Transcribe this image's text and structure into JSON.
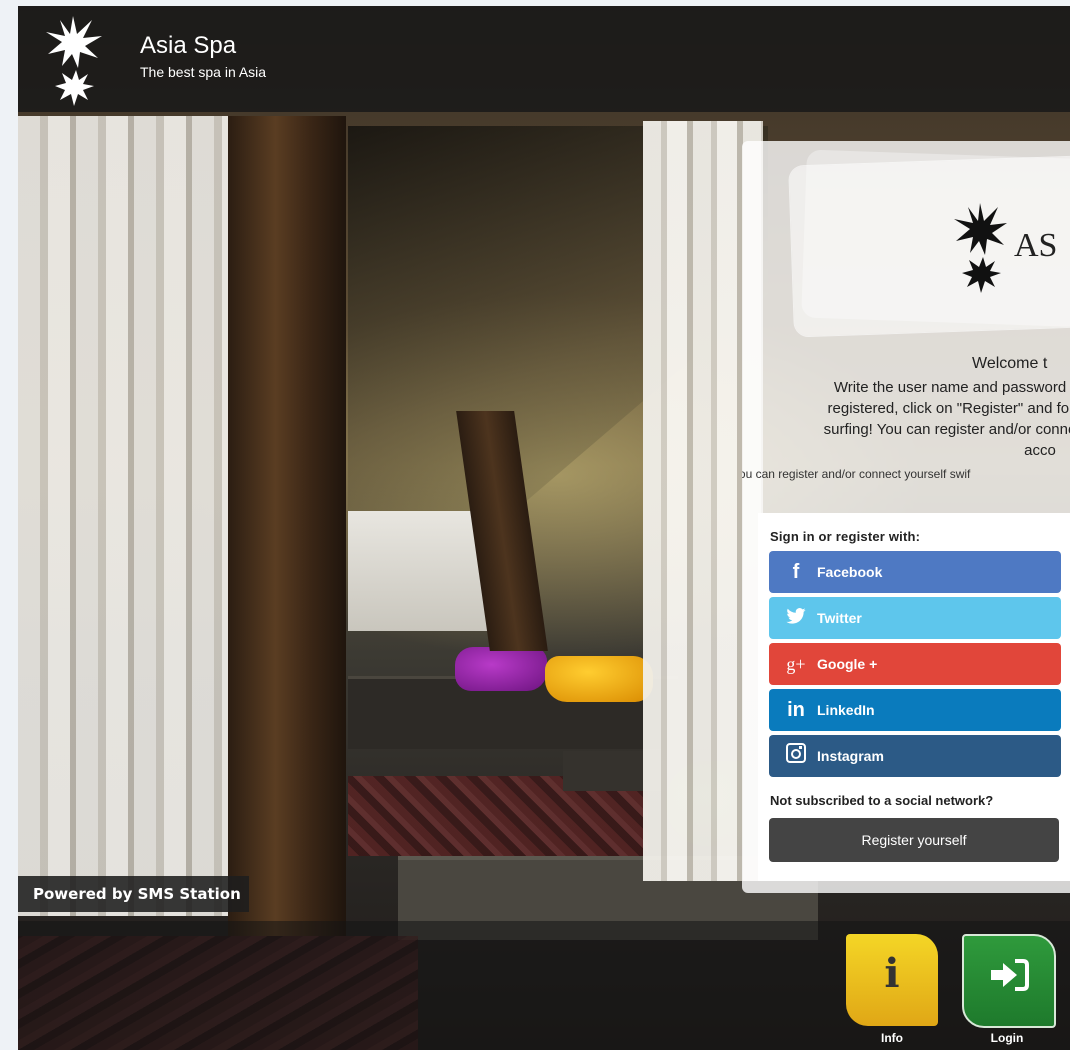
{
  "header": {
    "brand_name": "Asia Spa",
    "tagline": "The best spa in Asia"
  },
  "panel": {
    "logo_text": "AS",
    "welcome": "Welcome t",
    "description_lines": [
      "Write the user name and password",
      "registered, click on \"Register\" and fol",
      "surfing! You can register and/or conne",
      "acco"
    ],
    "swift_note": "You can register and/or connect yourself swif"
  },
  "social": {
    "title": "Sign in or register with:",
    "buttons": [
      {
        "label": "Facebook",
        "icon": "facebook-icon",
        "glyph": "f",
        "color": "#4e79c3"
      },
      {
        "label": "Twitter",
        "icon": "twitter-icon",
        "glyph": "🐦",
        "color": "#5ec6ec"
      },
      {
        "label": "Google +",
        "icon": "google-plus-icon",
        "glyph": "g+",
        "color": "#e1463a"
      },
      {
        "label": "LinkedIn",
        "icon": "linkedin-icon",
        "glyph": "in",
        "color": "#0a7bbd"
      },
      {
        "label": "Instagram",
        "icon": "instagram-icon",
        "glyph": "◙",
        "color": "#2c5a86"
      }
    ],
    "not_subscribed": "Not subscribed to a social network?",
    "register_label": "Register yourself"
  },
  "powered_by": "Powered by SMS Station",
  "footer": {
    "info_label": "Info",
    "login_label": "Login",
    "info_glyph": "i",
    "login_glyph": "➜"
  }
}
